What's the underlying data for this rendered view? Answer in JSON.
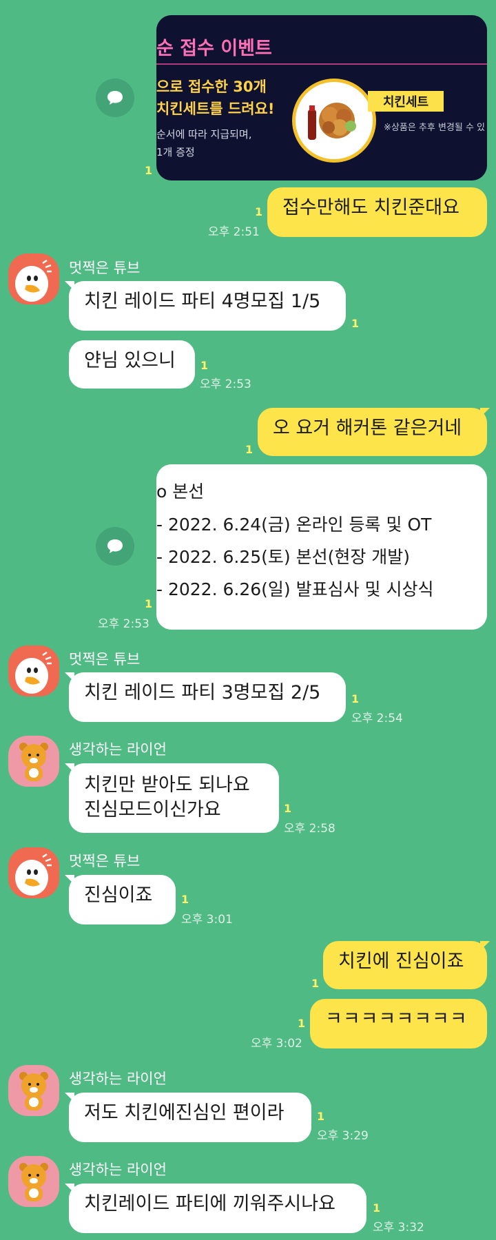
{
  "colors": {
    "background": "#4fba84",
    "my_bubble": "#fde44a",
    "their_bubble": "#ffffff",
    "unread": "#fff36a"
  },
  "icons": {
    "share": "share-speech-icon",
    "tube": "tube-duck-avatar",
    "lion": "ryan-lion-avatar"
  },
  "event_card": {
    "title": "순 접수 이벤트",
    "line1": "으로 접수한 30개",
    "line2": "치킨세트를 드려요!",
    "line3": "순서에 따라 지급되며,",
    "line4": "1개 증정",
    "tag": "치킨세트",
    "note": "※상품은 추후 변경될 수 있"
  },
  "messages": {
    "m1": {
      "unread": "1"
    },
    "m2": {
      "text": "접수만해도 치킨준대요",
      "unread": "1",
      "time": "오후 2:51"
    },
    "m3": {
      "sender": "멋쩍은 튜브",
      "text": "치킨 레이드 파티 4명모집 1/5",
      "unread": "1"
    },
    "m4": {
      "text": "얀님 있으니",
      "unread": "1",
      "time": "오후 2:53"
    },
    "m5": {
      "text": "오 요거 해커톤 같은거네",
      "unread": "1"
    },
    "m6": {
      "unread": "1",
      "time": "오후 2:53",
      "lines": [
        "o 본선",
        "- 2022. 6.24(금) 온라인 등록 및 OT",
        "- 2022. 6.25(토) 본선(현장 개발)",
        "- 2022. 6.26(일) 발표심사 및 시상식"
      ]
    },
    "m7": {
      "sender": "멋쩍은 튜브",
      "text": "치킨 레이드 파티 3명모집 2/5",
      "unread": "1",
      "time": "오후 2:54"
    },
    "m8": {
      "sender": "생각하는 라이언",
      "text": "치킨만 받아도 되나요\n진심모드이신가요",
      "unread": "1",
      "time": "오후 2:58"
    },
    "m9": {
      "sender": "멋쩍은 튜브",
      "text": "진심이죠",
      "unread": "1",
      "time": "오후 3:01"
    },
    "m10": {
      "text": "치킨에 진심이죠",
      "unread": "1"
    },
    "m11": {
      "text": "ㅋㅋㅋㅋㅋㅋㅋㅋ",
      "unread": "1",
      "time": "오후 3:02"
    },
    "m12": {
      "sender": "생각하는 라이언",
      "text": "저도 치킨에진심인 편이라",
      "unread": "1",
      "time": "오후 3:29"
    },
    "m13": {
      "sender": "생각하는 라이언",
      "text": "치킨레이드 파티에 끼워주시나요",
      "unread": "1",
      "time": "오후 3:32"
    }
  }
}
